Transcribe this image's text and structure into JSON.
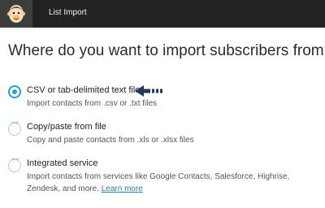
{
  "header": {
    "breadcrumb": "List Import",
    "logo_icon": "mailchimp-monkey-icon"
  },
  "page": {
    "title": "Where do you want to import subscribers from?"
  },
  "options": [
    {
      "label": "CSV or tab-delimited text file",
      "description": "Import contacts from .csv or .txt files",
      "selected": true
    },
    {
      "label": "Copy/paste from file",
      "description": "Copy and paste contacts from .xls or .xlsx files",
      "selected": false
    },
    {
      "label": "Integrated service",
      "description": "Import contacts from services like Google Contacts, Salesforce, Highrise, Zendesk, and more.",
      "link": "Learn more",
      "selected": false
    }
  ],
  "colors": {
    "topbar": "#222222",
    "accent": "#2a9fd6",
    "link": "#2a7fa6"
  }
}
